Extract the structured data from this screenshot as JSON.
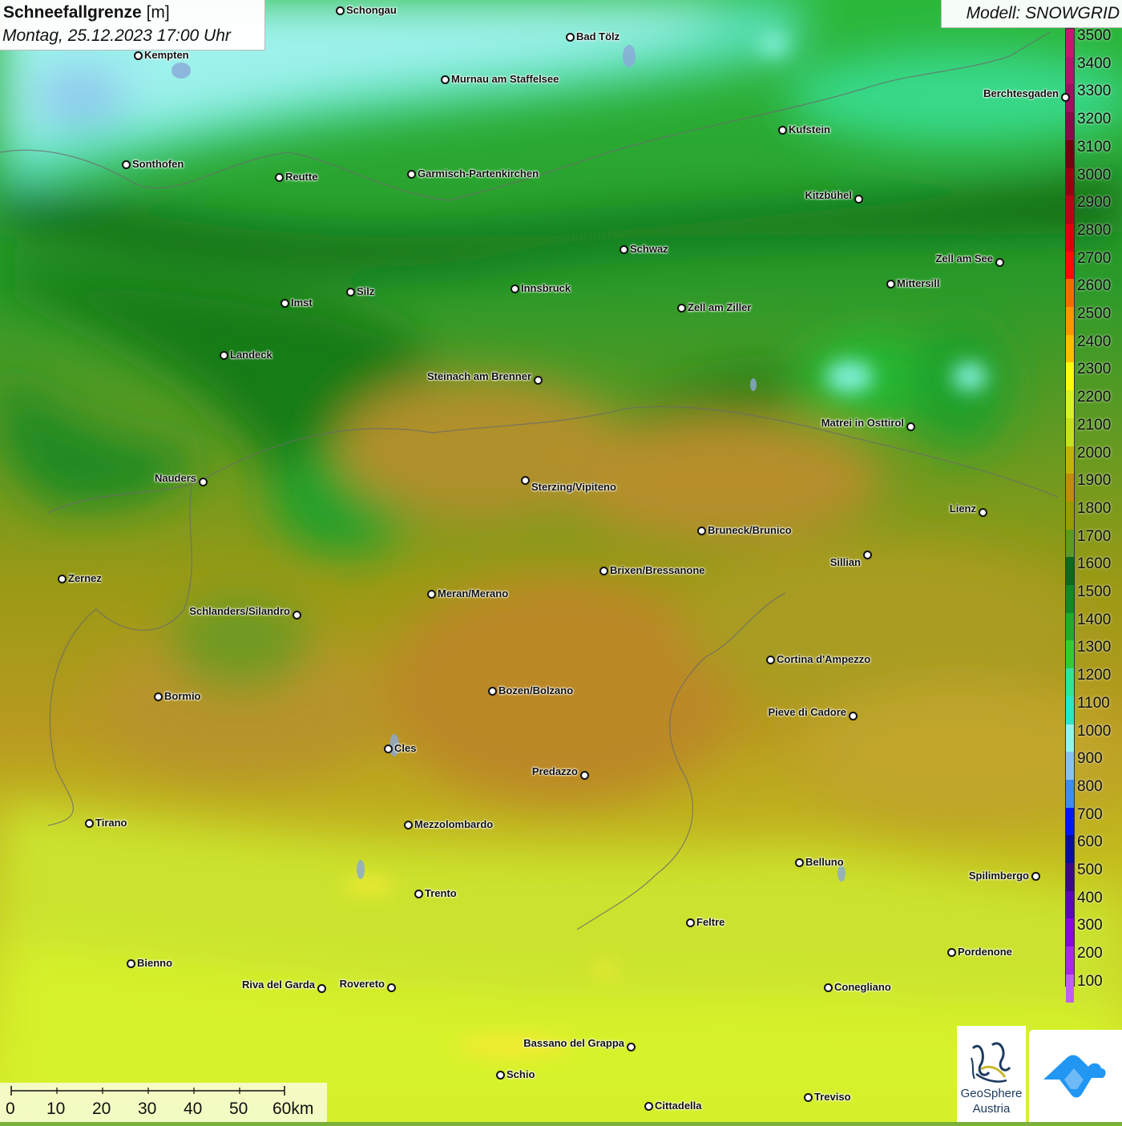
{
  "title": {
    "label_bold": "Schneefallgrenze",
    "unit": "[m]",
    "date": "Montag, 25.12.2023 17:00 Uhr"
  },
  "model": {
    "label": "Modell: SNOWGRID"
  },
  "legend": {
    "unit": "m",
    "entries": [
      {
        "value": "3500",
        "color": "#c8166e"
      },
      {
        "value": "3400",
        "color": "#b5146a"
      },
      {
        "value": "3300",
        "color": "#a10f60"
      },
      {
        "value": "3200",
        "color": "#8c0a4a"
      },
      {
        "value": "3100",
        "color": "#760010"
      },
      {
        "value": "3000",
        "color": "#9a0010"
      },
      {
        "value": "2900",
        "color": "#bd0015"
      },
      {
        "value": "2800",
        "color": "#dc0010"
      },
      {
        "value": "2700",
        "color": "#ff0c00"
      },
      {
        "value": "2600",
        "color": "#f86a00"
      },
      {
        "value": "2500",
        "color": "#f99500"
      },
      {
        "value": "2400",
        "color": "#fcbd00"
      },
      {
        "value": "2300",
        "color": "#fdfb13"
      },
      {
        "value": "2200",
        "color": "#d7f22c"
      },
      {
        "value": "2100",
        "color": "#c4e222"
      },
      {
        "value": "2000",
        "color": "#c0b30d"
      },
      {
        "value": "1900",
        "color": "#c08b10"
      },
      {
        "value": "1800",
        "color": "#979b04"
      },
      {
        "value": "1700",
        "color": "#5e9a22"
      },
      {
        "value": "1600",
        "color": "#0d6a16"
      },
      {
        "value": "1500",
        "color": "#128a1e"
      },
      {
        "value": "1400",
        "color": "#1bb024"
      },
      {
        "value": "1300",
        "color": "#2ad136"
      },
      {
        "value": "1200",
        "color": "#2ee59a"
      },
      {
        "value": "1100",
        "color": "#27e8c8"
      },
      {
        "value": "1000",
        "color": "#8ff5f0"
      },
      {
        "value": "900",
        "color": "#8ac2ee"
      },
      {
        "value": "800",
        "color": "#3d8cf0"
      },
      {
        "value": "700",
        "color": "#0018f2"
      },
      {
        "value": "600",
        "color": "#0a0e9e"
      },
      {
        "value": "500",
        "color": "#3c0a86"
      },
      {
        "value": "400",
        "color": "#5a08b8"
      },
      {
        "value": "300",
        "color": "#8808e0"
      },
      {
        "value": "200",
        "color": "#a82ae8"
      },
      {
        "value": "100",
        "color": "#c05ef0"
      }
    ]
  },
  "cities": [
    {
      "name": "Schongau"
    },
    {
      "name": "Bad Tölz"
    },
    {
      "name": "Kempten"
    },
    {
      "name": "Murnau am Staffelsee"
    },
    {
      "name": "Berchtesgaden"
    },
    {
      "name": "Kufstein"
    },
    {
      "name": "Sonthofen"
    },
    {
      "name": "Reutte"
    },
    {
      "name": "Garmisch-Partenkirchen"
    },
    {
      "name": "Kitzbühel"
    },
    {
      "name": "Schwaz"
    },
    {
      "name": "Zell am See"
    },
    {
      "name": "Mittersill"
    },
    {
      "name": "Innsbruck"
    },
    {
      "name": "Silz"
    },
    {
      "name": "Imst"
    },
    {
      "name": "Zell am Ziller"
    },
    {
      "name": "Landeck"
    },
    {
      "name": "Steinach am Brenner"
    },
    {
      "name": "Matrei in Osttirol"
    },
    {
      "name": "Nauders"
    },
    {
      "name": "Sterzing/Vipiteno"
    },
    {
      "name": "Lienz"
    },
    {
      "name": "Bruneck/Brunico"
    },
    {
      "name": "Sillian"
    },
    {
      "name": "Zernez"
    },
    {
      "name": "Brixen/Bressanone"
    },
    {
      "name": "Meran/Merano"
    },
    {
      "name": "Schlanders/Silandro"
    },
    {
      "name": "Cortina d'Ampezzo"
    },
    {
      "name": "Bozen/Bolzano"
    },
    {
      "name": "Bormio"
    },
    {
      "name": "Pieve di Cadore"
    },
    {
      "name": "Cles"
    },
    {
      "name": "Predazzo"
    },
    {
      "name": "Tirano"
    },
    {
      "name": "Mezzolombardo"
    },
    {
      "name": "Belluno"
    },
    {
      "name": "Spilimbergo"
    },
    {
      "name": "Trento"
    },
    {
      "name": "Feltre"
    },
    {
      "name": "Pordenone"
    },
    {
      "name": "Bienno"
    },
    {
      "name": "Riva del Garda"
    },
    {
      "name": "Rovereto"
    },
    {
      "name": "Conegliano"
    },
    {
      "name": "Bassano del Grappa"
    },
    {
      "name": "Schio"
    },
    {
      "name": "Treviso"
    },
    {
      "name": "Cittadella"
    }
  ],
  "scale": {
    "ticks": [
      "0",
      "10",
      "20",
      "30",
      "40",
      "50",
      "60km"
    ]
  },
  "logos": {
    "geosphere_line1": "GeoSphere",
    "geosphere_line2": "Austria"
  },
  "colors": {
    "lowland_cyan": "#8ff5f0",
    "valley_green": "#128a1e",
    "south_ochre": "#c08b10",
    "po_plain_yellowgreen": "#d7f22c"
  }
}
